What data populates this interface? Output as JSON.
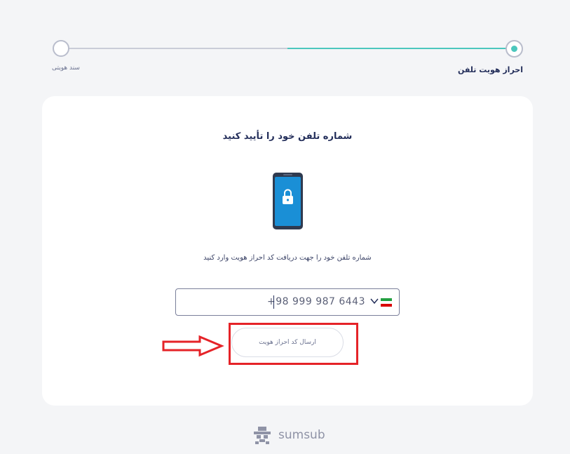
{
  "stepper": {
    "step_left_label": "سند هویتی",
    "step_right_label": "احراز هویت تلفن"
  },
  "card": {
    "title": "شماره تلفن خود را تأیید کنید",
    "description": "شماره تلفن خود را جهت دریافت کد احراز هویت وارد کنید",
    "phone_value": "+98 999 987 6443",
    "send_button_label": "ارسال کد احراز هویت"
  },
  "icons": {
    "phone": "phone-lock-icon",
    "flag": "iran-flag-icon",
    "chevron": "chevron-down-icon",
    "arrow": "right-arrow-annotation-icon",
    "logo": "sumsub-logo-icon"
  },
  "colors": {
    "accent": "#4cc7bd",
    "annotation": "#e52328",
    "text": "#232e5a",
    "phone_screen": "#1a8fd6"
  },
  "footer": {
    "logo_text": "sumsub"
  }
}
